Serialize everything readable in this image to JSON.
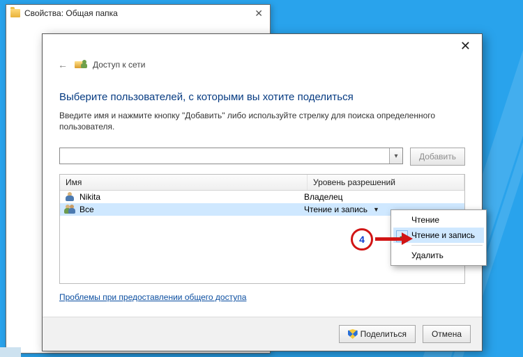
{
  "props_window": {
    "title": "Свойства: Общая папка"
  },
  "share_dialog": {
    "crumb": "Доступ к сети",
    "heading": "Выберите пользователей, с которыми вы хотите поделиться",
    "instructions": "Введите имя и нажмите кнопку \"Добавить\" либо используйте стрелку для поиска определенного пользователя.",
    "add_label": "Добавить",
    "columns": {
      "name": "Имя",
      "perm": "Уровень разрешений"
    },
    "rows": [
      {
        "name": "Nikita",
        "perm": "Владелец",
        "icon": "user",
        "selected": false,
        "show_caret": false
      },
      {
        "name": "Все",
        "perm": "Чтение и запись",
        "icon": "group",
        "selected": true,
        "show_caret": true
      }
    ],
    "troubleshoot": "Проблемы при предоставлении общего доступа",
    "footer": {
      "share": "Поделиться",
      "cancel": "Отмена"
    }
  },
  "perm_menu": {
    "items": [
      {
        "label": "Чтение",
        "checked": false,
        "hover": false
      },
      {
        "label": "Чтение и запись",
        "checked": true,
        "hover": true
      }
    ],
    "separator_then": {
      "label": "Удалить"
    }
  },
  "annotation": {
    "number": "4"
  }
}
